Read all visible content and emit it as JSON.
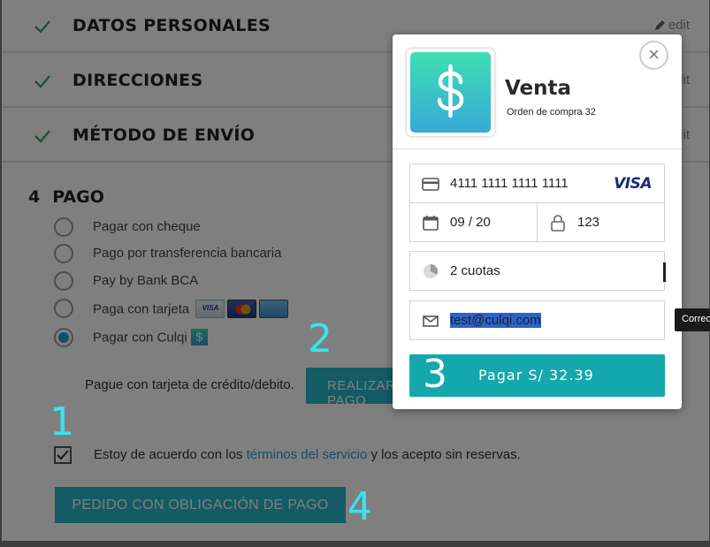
{
  "checkout": {
    "steps": [
      {
        "title": "DATOS PERSONALES",
        "edit": "edit"
      },
      {
        "title": "DIRECCIONES",
        "edit": "edit"
      },
      {
        "title": "MÉTODO DE ENVÍO",
        "edit": "edit"
      }
    ],
    "payment": {
      "number": "4",
      "title": "PAGO",
      "options": [
        {
          "label": "Pagar con cheque",
          "selected": false
        },
        {
          "label": "Pago por transferencia bancaria",
          "selected": false
        },
        {
          "label": "Pay by Bank BCA",
          "selected": false
        },
        {
          "label": "Paga con tarjeta",
          "selected": false
        },
        {
          "label": "Pagar con Culqi",
          "selected": true
        }
      ],
      "card_logos": [
        "VISA",
        "MasterCard",
        "AMEX"
      ],
      "culqi_icon": "$",
      "note": "Pague con tarjeta de crédito/debito.",
      "realizar_label": "REALIZAR PAGO"
    },
    "terms": {
      "checked": true,
      "before": "Estoy de acuerdo con los ",
      "link": "términos del servicio",
      "after": " y los acepto sin reservas."
    },
    "order_button": "PEDIDO CON OBLIGACIÓN DE PAGO"
  },
  "annotations": [
    "1",
    "2",
    "3",
    "4"
  ],
  "modal": {
    "merchant": "Venta",
    "order_ref": "Orden de compra 32",
    "logo_symbol": "$",
    "close": "×",
    "card_number": "4111 1111 1111 1111",
    "card_brand": "VISA",
    "expiry": "09 / 20",
    "cvv": "123",
    "installments": "2 cuotas",
    "email": "test@culqi.com",
    "pay_label": "Pagar S/ 32.39"
  },
  "tooltip": "Correo",
  "colors": {
    "accent": "#28b7c8",
    "pay_button": "#14a8ad",
    "check": "#3aa66b",
    "annotation": "#38e3f0",
    "link": "#2a9bd6"
  }
}
